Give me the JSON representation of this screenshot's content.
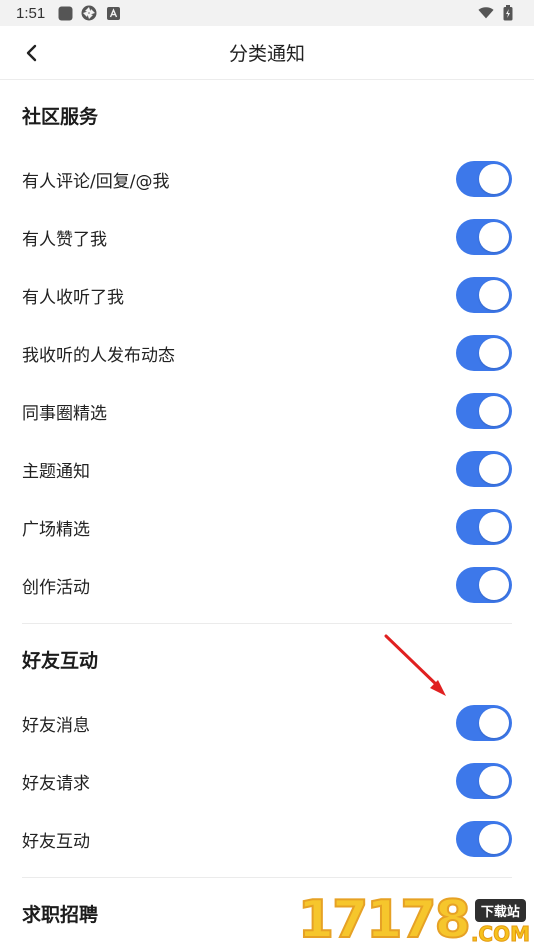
{
  "status_bar": {
    "time": "1:51",
    "icons": [
      "square-app-icon",
      "aperture-icon",
      "a-box-icon"
    ],
    "right_icons": [
      "wifi-icon",
      "battery-icon"
    ]
  },
  "nav": {
    "back_icon": "chevron-left-icon",
    "title": "分类通知"
  },
  "sections": [
    {
      "title": "社区服务",
      "items": [
        {
          "label": "有人评论/回复/@我",
          "enabled": true
        },
        {
          "label": "有人赞了我",
          "enabled": true
        },
        {
          "label": "有人收听了我",
          "enabled": true
        },
        {
          "label": "我收听的人发布动态",
          "enabled": true
        },
        {
          "label": "同事圈精选",
          "enabled": true
        },
        {
          "label": "主题通知",
          "enabled": true
        },
        {
          "label": "广场精选",
          "enabled": true
        },
        {
          "label": "创作活动",
          "enabled": true
        }
      ]
    },
    {
      "title": "好友互动",
      "items": [
        {
          "label": "好友消息",
          "enabled": true
        },
        {
          "label": "好友请求",
          "enabled": true
        },
        {
          "label": "好友互动",
          "enabled": true
        }
      ]
    },
    {
      "title": "求职招聘",
      "items": []
    }
  ],
  "colors": {
    "toggle_on": "#3d78ea",
    "arrow": "#e02020",
    "watermark_yellow": "#f6c21b"
  },
  "watermark": {
    "digits": "17178",
    "badge": "下载站",
    "suffix": ".COM"
  }
}
